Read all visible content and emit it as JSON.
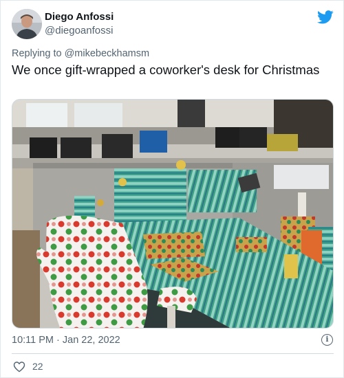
{
  "author": {
    "name": "Diego Anfossi",
    "handle": "@diegoanfossi",
    "avatar_icon": "user-avatar"
  },
  "brand": {
    "icon": "twitter-bird-icon",
    "color": "#1d9bf0"
  },
  "reply_line": "Replying to @mikebeckhamsm",
  "tweet_text": "We once gift-wrapped a coworker's desk for Christmas",
  "timestamp": "10:11 PM · Jan 22, 2022",
  "likes": {
    "icon": "heart-icon",
    "count": "22"
  },
  "colors": {
    "text": "#0f1419",
    "secondary": "#536471",
    "border": "#cfd9de"
  }
}
